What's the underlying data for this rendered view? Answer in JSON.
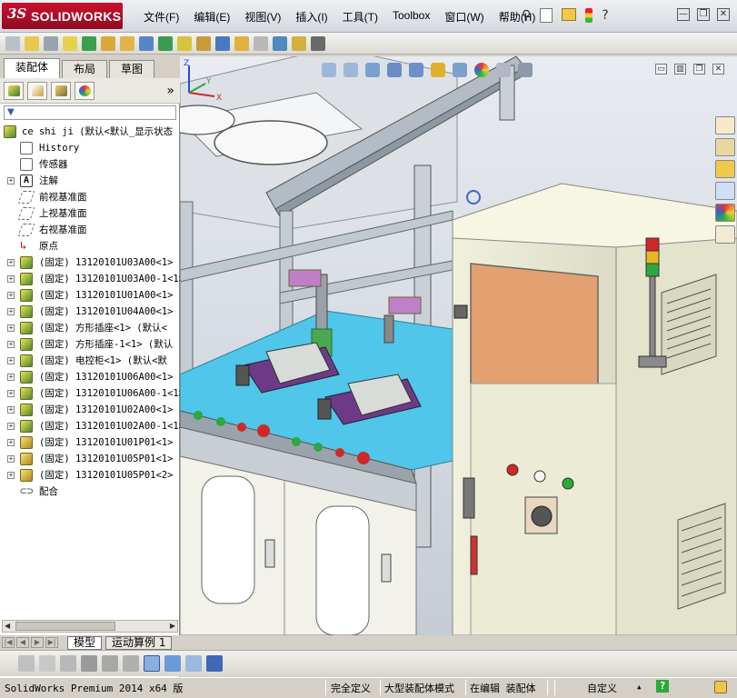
{
  "app": {
    "logo_ds": "3S",
    "logo_name": "SOLIDWORKS"
  },
  "menu": [
    "文件(F)",
    "编辑(E)",
    "视图(V)",
    "插入(I)",
    "工具(T)",
    "Toolbox",
    "窗口(W)",
    "帮助(H)"
  ],
  "title_tools": {
    "pin": "⚲",
    "help": "?"
  },
  "window_controls": {
    "minimize": "—",
    "restore": "❐",
    "close": "✕"
  },
  "panel_tabs": [
    "装配体",
    "布局",
    "草图"
  ],
  "panel_icons": [
    "featuremanager-icon",
    "propertymanager-icon",
    "configmanager-icon",
    "displaymanager-icon"
  ],
  "panel_expand": "»",
  "filter": "▼",
  "tree": {
    "root": "ce shi ji  (默认<默认_显示状态",
    "items": [
      {
        "label": "History",
        "icon": "history",
        "exp": false
      },
      {
        "label": "传感器",
        "icon": "sensor",
        "exp": false
      },
      {
        "label": "注解",
        "icon": "annotation",
        "exp": true
      },
      {
        "label": "前视基准面",
        "icon": "plane",
        "exp": false
      },
      {
        "label": "上视基准面",
        "icon": "plane",
        "exp": false
      },
      {
        "label": "右视基准面",
        "icon": "plane",
        "exp": false
      },
      {
        "label": "原点",
        "icon": "origin",
        "exp": false
      },
      {
        "label": "(固定) 13120101U03A00<1>",
        "icon": "assembly",
        "exp": true
      },
      {
        "label": "(固定) 13120101U03A00-1<1>",
        "icon": "assembly",
        "exp": true
      },
      {
        "label": "(固定) 13120101U01A00<1>",
        "icon": "assembly",
        "exp": true
      },
      {
        "label": "(固定) 13120101U04A00<1>",
        "icon": "assembly",
        "exp": true
      },
      {
        "label": "(固定) 方形插座<1> (默认<",
        "icon": "assembly",
        "exp": true
      },
      {
        "label": "(固定) 方形插座-1<1> (默认",
        "icon": "assembly",
        "exp": true
      },
      {
        "label": "(固定) 电控柜<1> (默认<默",
        "icon": "assembly",
        "exp": true
      },
      {
        "label": "(固定) 13120101U06A00<1>",
        "icon": "assembly",
        "exp": true
      },
      {
        "label": "(固定) 13120101U06A00-1<1>",
        "icon": "assembly",
        "exp": true
      },
      {
        "label": "(固定) 13120101U02A00<1>",
        "icon": "assembly",
        "exp": true
      },
      {
        "label": "(固定) 13120101U02A00-1<1>",
        "icon": "assembly",
        "exp": true
      },
      {
        "label": "(固定) 13120101U01P01<1>",
        "icon": "part",
        "exp": true
      },
      {
        "label": "(固定) 13120101U05P01<1>",
        "icon": "part",
        "exp": true
      },
      {
        "label": "(固定) 13120101U05P01<2>",
        "icon": "part",
        "exp": true
      },
      {
        "label": "配合",
        "icon": "mates",
        "exp": false
      }
    ]
  },
  "bottom_tabs": [
    "模型",
    "运动算例 1"
  ],
  "status": {
    "product": "SolidWorks Premium 2014 x64 版",
    "defined": "完全定义",
    "mode": "大型装配体模式",
    "editing": "在编辑 装配体",
    "custom": "自定义",
    "help": "?"
  },
  "colors": {
    "brand": "#c8102e",
    "table_top": "#4fc6ea",
    "frame": "#b9c2cb",
    "cabinet": "#efeed9",
    "panel_orange": "#e3a070"
  }
}
